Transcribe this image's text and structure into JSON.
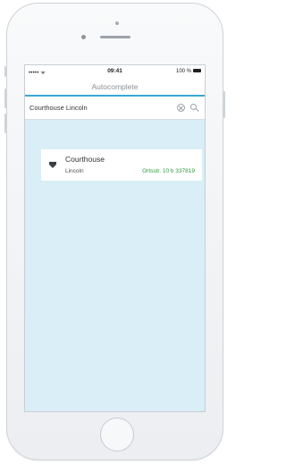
{
  "status_bar": {
    "signal": "••••• ᯤ",
    "time": "09:41",
    "battery_text": "100 %"
  },
  "nav": {
    "title": "Autocomplete"
  },
  "search": {
    "value": "Courthouse Lincoln"
  },
  "results": [
    {
      "title": "Courthouse",
      "city": "Lincoln",
      "address": "Ortsstr. 10 b 337819",
      "icon": "map-pin-icon"
    }
  ],
  "colors": {
    "accent": "#3aa7d4",
    "screen_bg": "#d9eef6",
    "address_green": "#2f9a3e"
  }
}
